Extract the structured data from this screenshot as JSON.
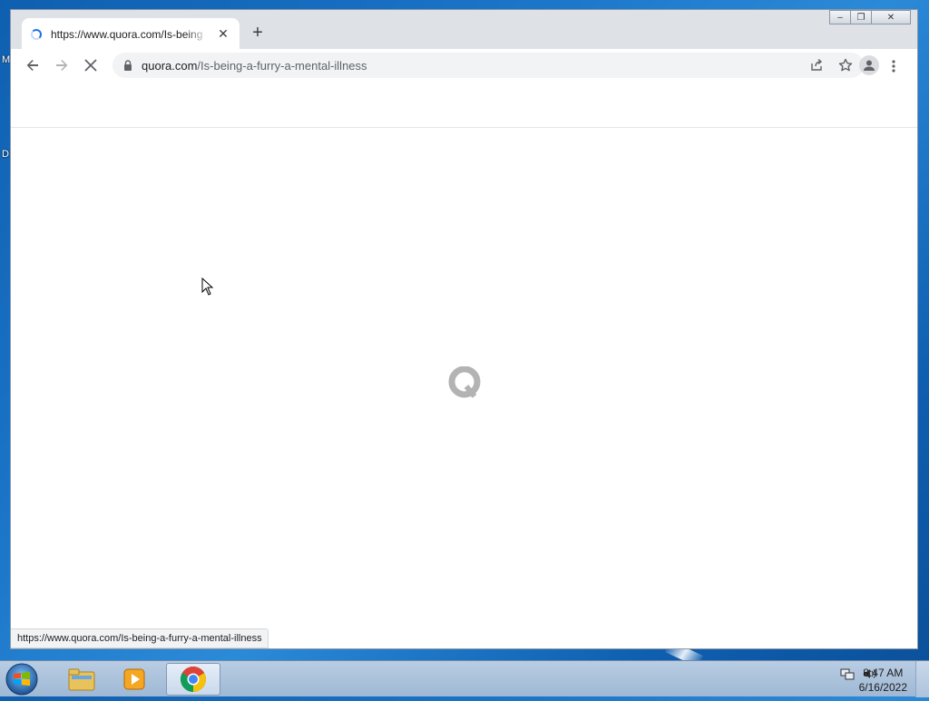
{
  "desktop": {
    "label_1": "M",
    "label_2": "D"
  },
  "browser": {
    "tab": {
      "title": "https://www.quora.com/Is-being"
    },
    "omnibox": {
      "host": "quora.com",
      "path": "/Is-being-a-furry-a-mental-illness"
    },
    "status_url": "https://www.quora.com/Is-being-a-furry-a-mental-illness"
  },
  "icons": [
    "back-icon",
    "forward-icon",
    "stop-loading-icon",
    "lock-icon",
    "share-icon",
    "star-icon",
    "profile-icon",
    "menu-icon",
    "quora-logo-icon"
  ],
  "taskbar": {
    "time": "8:47 AM",
    "date": "6/16/2022"
  },
  "colors": {
    "accent": "#1a73e8",
    "quora_logo": "#b3b3b3"
  }
}
